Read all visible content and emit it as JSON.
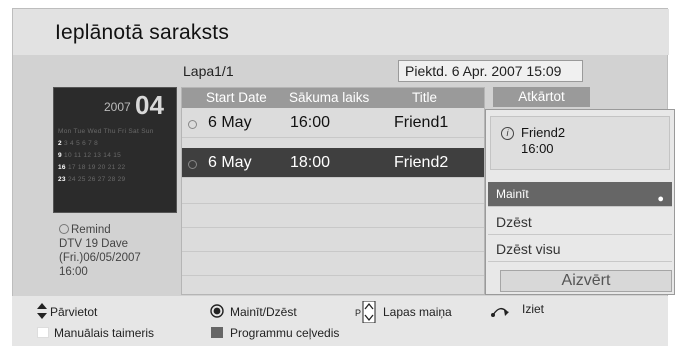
{
  "screen": {
    "title": "Ieplānotā saraksts",
    "page_label": "Lapa1/1",
    "datetime": "Piektd. 6 Apr. 2007 15:09"
  },
  "calendar": {
    "year": "2007",
    "month": "04"
  },
  "remind": {
    "label": "Remind",
    "channel": "DTV 19 Dave",
    "date": "(Fri.)06/05/2007",
    "time": "16:00"
  },
  "table": {
    "headers": [
      "Start Date",
      "Sākuma laiks",
      "Title",
      "Atkārtot"
    ],
    "rows": [
      {
        "date": "6 May",
        "time": "16:00",
        "title": "Friend1"
      },
      {
        "date": "6 May",
        "time": "18:00",
        "title": "Friend2"
      }
    ]
  },
  "popup": {
    "title": "Friend2",
    "time": "16:00",
    "menu": [
      "Mainīt",
      "Dzēst",
      "Dzēst visu"
    ],
    "close": "Aizvērt"
  },
  "footer": {
    "move": "Pārvietot",
    "edit_delete": "Mainīt/Dzēst",
    "page_change": "Lapas maiņa",
    "exit": "Iziet",
    "manual_timer": "Manuālais taimeris",
    "program_guide": "Programmu ceļvedis"
  },
  "icons": {
    "move": "up-down-arrows-icon",
    "ok": "ok-button-icon",
    "page": "page-up-down-icon",
    "exit": "return-icon",
    "info": "info-icon",
    "clock": "clock-icon"
  }
}
